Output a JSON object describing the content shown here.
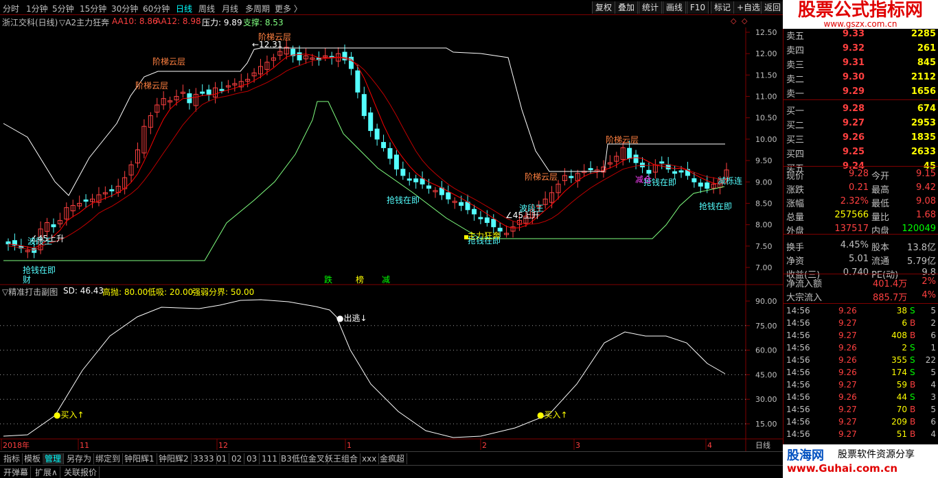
{
  "periods": [
    "分时",
    "1分钟",
    "5分钟",
    "15分钟",
    "30分钟",
    "60分钟",
    "日线",
    "周线",
    "月线",
    "多周期",
    "更多 〉"
  ],
  "active_period": "日线",
  "right_buttons": [
    "复权",
    "叠加",
    "统计",
    "画线",
    "F10",
    "标记",
    "+自选",
    "返回"
  ],
  "info": {
    "stock": "浙江交科(日线)",
    "indicator": "▽A2主力狂奔",
    "aa10": "AA10: 8.86",
    "aa12": "AA12: 8.98",
    "pressure": "压力: 9.89",
    "support": "支撑: 8.53"
  },
  "sub_info": {
    "name": "▽精准打击副图",
    "sd": "SD: 46.43",
    "high": "高抛: 80.00",
    "low": "低吸: 20.00",
    "boundary": "强弱分界: 50.00"
  },
  "main_axis": [
    "12.50",
    "12.00",
    "11.50",
    "11.00",
    "10.50",
    "10.00",
    "9.50",
    "9.00",
    "8.50",
    "8.00",
    "7.50",
    "7.00"
  ],
  "sub_axis": [
    "90.00",
    "75.00",
    "60.00",
    "45.00",
    "30.00",
    "15.00"
  ],
  "date_labels": [
    "2018年",
    "11",
    "12",
    "1",
    "2",
    "3",
    "4"
  ],
  "period_label": "日线",
  "annotations": {
    "ladder": "阶梯云层",
    "grab": "抢钱在即",
    "wave": "波段王",
    "up45": "∠45上升",
    "peak": "←12.31",
    "fortune": "财",
    "fall": "跌",
    "list": "榜",
    "reduce": "减",
    "main_run": "主力狂奔",
    "escape": "●出逃↓",
    "buy": "●买入↑",
    "reduce_pos": "减仓",
    "strong": "减栎连"
  },
  "ad": {
    "title": "股票公式指标网",
    "url": "www.gszx.com.cn",
    "bottom_title": "股海网",
    "bottom_sub": "股票软件资源分享",
    "bottom_url": "www.Guhai.com.cn"
  },
  "orderbook": [
    {
      "label": "卖五",
      "price": "9.33",
      "vol": "2285",
      "pc": "#ff4040",
      "vc": "#ffff00"
    },
    {
      "label": "卖四",
      "price": "9.32",
      "vol": "261",
      "pc": "#ff4040",
      "vc": "#ffff00"
    },
    {
      "label": "卖三",
      "price": "9.31",
      "vol": "845",
      "pc": "#ff4040",
      "vc": "#ffff00"
    },
    {
      "label": "卖二",
      "price": "9.30",
      "vol": "2112",
      "pc": "#ff4040",
      "vc": "#ffff00"
    },
    {
      "label": "卖一",
      "price": "9.29",
      "vol": "1656",
      "pc": "#ff4040",
      "vc": "#ffff00"
    },
    {
      "label": "买一",
      "price": "9.28",
      "vol": "674",
      "pc": "#ff4040",
      "vc": "#ffff00"
    },
    {
      "label": "买二",
      "price": "9.27",
      "vol": "2953",
      "pc": "#ff4040",
      "vc": "#ffff00"
    },
    {
      "label": "买三",
      "price": "9.26",
      "vol": "1835",
      "pc": "#ff4040",
      "vc": "#ffff00"
    },
    {
      "label": "买四",
      "price": "9.25",
      "vol": "2633",
      "pc": "#ff4040",
      "vc": "#ffff00"
    },
    {
      "label": "买五",
      "price": "9.24",
      "vol": "45",
      "pc": "#ff4040",
      "vc": "#ffff00"
    }
  ],
  "stats": [
    {
      "l1": "现价",
      "v1": "9.28",
      "c1": "#ff4040",
      "l2": "今开",
      "v2": "9.15",
      "c2": "#ff4040"
    },
    {
      "l1": "涨跌",
      "v1": "0.21",
      "c1": "#ff4040",
      "l2": "最高",
      "v2": "9.42",
      "c2": "#ff4040"
    },
    {
      "l1": "涨幅",
      "v1": "2.32%",
      "c1": "#ff4040",
      "l2": "最低",
      "v2": "9.08",
      "c2": "#ff4040"
    },
    {
      "l1": "总量",
      "v1": "257566",
      "c1": "#ffff00",
      "l2": "量比",
      "v2": "1.68",
      "c2": "#ff4040"
    },
    {
      "l1": "外盘",
      "v1": "137517",
      "c1": "#ff4040",
      "l2": "内盘",
      "v2": "120049",
      "c2": "#00ff00"
    },
    {
      "l1": "换手",
      "v1": "4.45%",
      "c1": "#c0c0c0",
      "l2": "股本",
      "v2": "13.8亿",
      "c2": "#c0c0c0"
    },
    {
      "l1": "净资",
      "v1": "5.01",
      "c1": "#c0c0c0",
      "l2": "流通",
      "v2": "5.79亿",
      "c2": "#c0c0c0"
    },
    {
      "l1": "收益(三)",
      "v1": "0.740",
      "c1": "#c0c0c0",
      "l2": "PE(动)",
      "v2": "9.8",
      "c2": "#c0c0c0"
    }
  ],
  "flows": [
    {
      "label": "净流入额",
      "value": "401.4万",
      "pct": "2%"
    },
    {
      "label": "大宗流入",
      "value": "885.7万",
      "pct": "4%"
    }
  ],
  "ticks": [
    {
      "t": "14:56",
      "p": "9.26",
      "v": "38",
      "s": "S",
      "n": "5"
    },
    {
      "t": "14:56",
      "p": "9.27",
      "v": "6",
      "s": "B",
      "n": "2"
    },
    {
      "t": "14:56",
      "p": "9.27",
      "v": "408",
      "s": "B",
      "n": "6"
    },
    {
      "t": "14:56",
      "p": "9.26",
      "v": "2",
      "s": "S",
      "n": "1"
    },
    {
      "t": "14:56",
      "p": "9.26",
      "v": "355",
      "s": "S",
      "n": "22"
    },
    {
      "t": "14:56",
      "p": "9.26",
      "v": "174",
      "s": "S",
      "n": "5"
    },
    {
      "t": "14:56",
      "p": "9.27",
      "v": "59",
      "s": "B",
      "n": "4"
    },
    {
      "t": "14:56",
      "p": "9.26",
      "v": "44",
      "s": "S",
      "n": "3"
    },
    {
      "t": "14:56",
      "p": "9.27",
      "v": "70",
      "s": "B",
      "n": "5"
    },
    {
      "t": "14:56",
      "p": "9.27",
      "v": "209",
      "s": "B",
      "n": "6"
    },
    {
      "t": "14:56",
      "p": "9.27",
      "v": "51",
      "s": "B",
      "n": "4"
    }
  ],
  "bottom_tabs": [
    "指标",
    "模板",
    "管理",
    "另存为",
    "绑定到",
    "钟阳辉1",
    "钟阳辉2",
    "3333",
    "01",
    "02",
    "03",
    "111",
    "B3低位金叉",
    "妖王组合",
    "xxx",
    "金疯超"
  ],
  "selected_tab": "管理",
  "bottom2_tabs": [
    "开弹幕",
    "扩展∧",
    "关联报价"
  ],
  "colors": {
    "up": "#ff4040",
    "down": "#54ffff",
    "ma1": "#ff0000",
    "ma2": "#c00000",
    "cloud": "#ffffff",
    "support": "#80ff80",
    "grid": "#800000"
  }
}
